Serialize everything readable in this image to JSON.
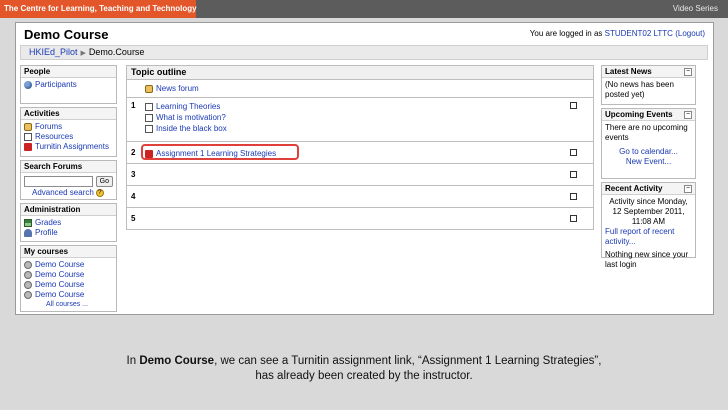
{
  "slide": {
    "org_label": "The Centre for Learning, Teaching and Technology",
    "series_label": "Video Series",
    "caption_line1_pre": "In ",
    "caption_course": "Demo Course",
    "caption_line1_post": ", we can see a Turnitin assignment link, “Assignment 1 Learning Strategies”,",
    "caption_line2": "has already been created by the instructor."
  },
  "header": {
    "site_title": "Demo Course",
    "login_prefix": "You are logged in as",
    "user_name": "STUDENT02 LTTC",
    "logout": "(Logout)"
  },
  "navbar": {
    "crumbs": [
      "HKIEd_Pilot",
      "Demo.Course"
    ],
    "separator": "▶"
  },
  "left": {
    "people": {
      "title": "People",
      "items": [
        {
          "label": "Participants",
          "icon": "people-icon"
        }
      ]
    },
    "activities": {
      "title": "Activities",
      "items": [
        {
          "label": "Forums",
          "icon": "forum-icon"
        },
        {
          "label": "Resources",
          "icon": "resource-icon"
        },
        {
          "label": "Turnitin Assignments",
          "icon": "turnitin-icon"
        }
      ]
    },
    "search": {
      "title": "Search Forums",
      "go": "Go",
      "advanced": "Advanced search",
      "help": "?"
    },
    "admin": {
      "title": "Administration",
      "items": [
        {
          "label": "Grades",
          "icon": "grades-icon"
        },
        {
          "label": "Profile",
          "icon": "profile-icon"
        }
      ]
    },
    "courses": {
      "title": "My courses",
      "items": [
        "Demo Course",
        "Demo Course",
        "Demo Course",
        "Demo Course"
      ],
      "all": "All courses ..."
    }
  },
  "topics": {
    "title": "Topic outline",
    "section0": {
      "items": [
        "News forum"
      ]
    },
    "section1": {
      "num": "1",
      "items": [
        "Learning Theories",
        "What is motivation?",
        "Inside the black box"
      ]
    },
    "section2": {
      "num": "2",
      "items": [
        "Assignment 1 Learning Strategies"
      ]
    },
    "section3": {
      "num": "3"
    },
    "section4": {
      "num": "4"
    },
    "section5": {
      "num": "5"
    }
  },
  "right": {
    "news": {
      "title": "Latest News",
      "body": "(No news has been posted yet)"
    },
    "events": {
      "title": "Upcoming Events",
      "body": "There are no upcoming events",
      "calendar": "Go to calendar...",
      "new_event": "New Event..."
    },
    "activity": {
      "title": "Recent Activity",
      "since": "Activity since Monday, 12 September 2011, 11:08 AM",
      "report": "Full report of recent activity...",
      "nothing": "Nothing new since your last login"
    }
  },
  "colors": {
    "accent_bar": "#e2562a",
    "link": "#1a39b5",
    "highlight": "#e0403a"
  }
}
